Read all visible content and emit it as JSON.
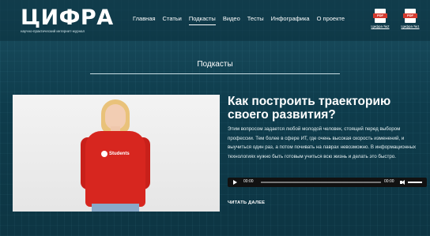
{
  "header": {
    "logo": "ЦИФРА",
    "logo_subtitle": "научно-практический интернет-журнал",
    "nav": [
      {
        "label": "Главная",
        "active": false
      },
      {
        "label": "Статьи",
        "active": false
      },
      {
        "label": "Подкасты",
        "active": true
      },
      {
        "label": "Видео",
        "active": false
      },
      {
        "label": "Тесты",
        "active": false
      },
      {
        "label": "Инфографика",
        "active": false
      },
      {
        "label": "О проекте",
        "active": false
      }
    ],
    "downloads": [
      {
        "icon": "pdf-icon",
        "badge": "PDF",
        "label": "Цифра №2"
      },
      {
        "icon": "pdf-icon",
        "badge": "PDF",
        "label": "Цифра №1"
      }
    ]
  },
  "section": {
    "title": "Подкасты"
  },
  "article": {
    "title": "Как построить траекторию своего развития?",
    "body": "Этим вопросом задается любой молодой человек, стоящий перед выбором профессии. Тем более в сфере ИТ, где очень высокая скорость изменений, и выучиться один раз, а потом почивать на лаврах невозможно. В информационных технологиях нужно быть готовым учиться всю жизнь и делать это быстро.",
    "photo_logo": "Students",
    "player": {
      "current": "00:00",
      "duration": "00:00"
    },
    "read_more": "ЧИТАТЬ ДАЛЕЕ"
  },
  "colors": {
    "background": "#0f3b4a",
    "accent_red": "#d7261f",
    "text": "#ffffff"
  }
}
